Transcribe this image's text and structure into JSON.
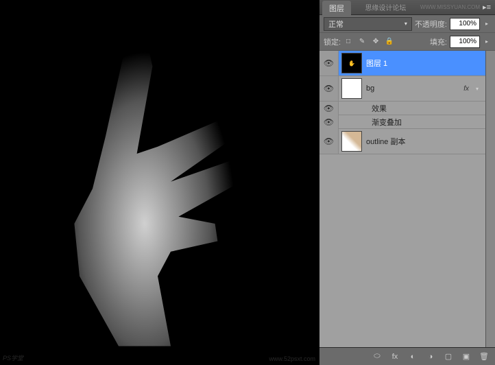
{
  "panel": {
    "tab_label": "图层",
    "header_title": "思缘设计论坛",
    "header_url": "WWW.MISSYUAN.COM"
  },
  "blend_row": {
    "mode": "正常",
    "opacity_label": "不透明度:",
    "opacity_value": "100%"
  },
  "lock_row": {
    "lock_label": "锁定:",
    "fill_label": "填充:",
    "fill_value": "100%",
    "icons": {
      "transparency": "□",
      "image": "✎",
      "position": "✥",
      "all": "🔒"
    }
  },
  "layers": [
    {
      "name": "图层 1",
      "selected": true,
      "visible": true,
      "thumb_class": "thumb-dark"
    },
    {
      "name": "bg",
      "selected": false,
      "visible": true,
      "thumb_class": "",
      "has_fx": true,
      "fx_label": "fx",
      "effects_label": "效果",
      "effects": [
        {
          "name": "渐变叠加",
          "visible": true
        }
      ]
    },
    {
      "name": "outline 副本",
      "selected": false,
      "visible": true,
      "thumb_class": "thumb-outline"
    }
  ],
  "watermarks": {
    "left": "PS学堂",
    "right": "www.52psxt.com"
  },
  "bottom_icons": {
    "link": "⬭",
    "fx": "fx",
    "mask": "◐",
    "adjust": "◑",
    "folder": "▢",
    "new": "▣",
    "trash": "🗑"
  }
}
